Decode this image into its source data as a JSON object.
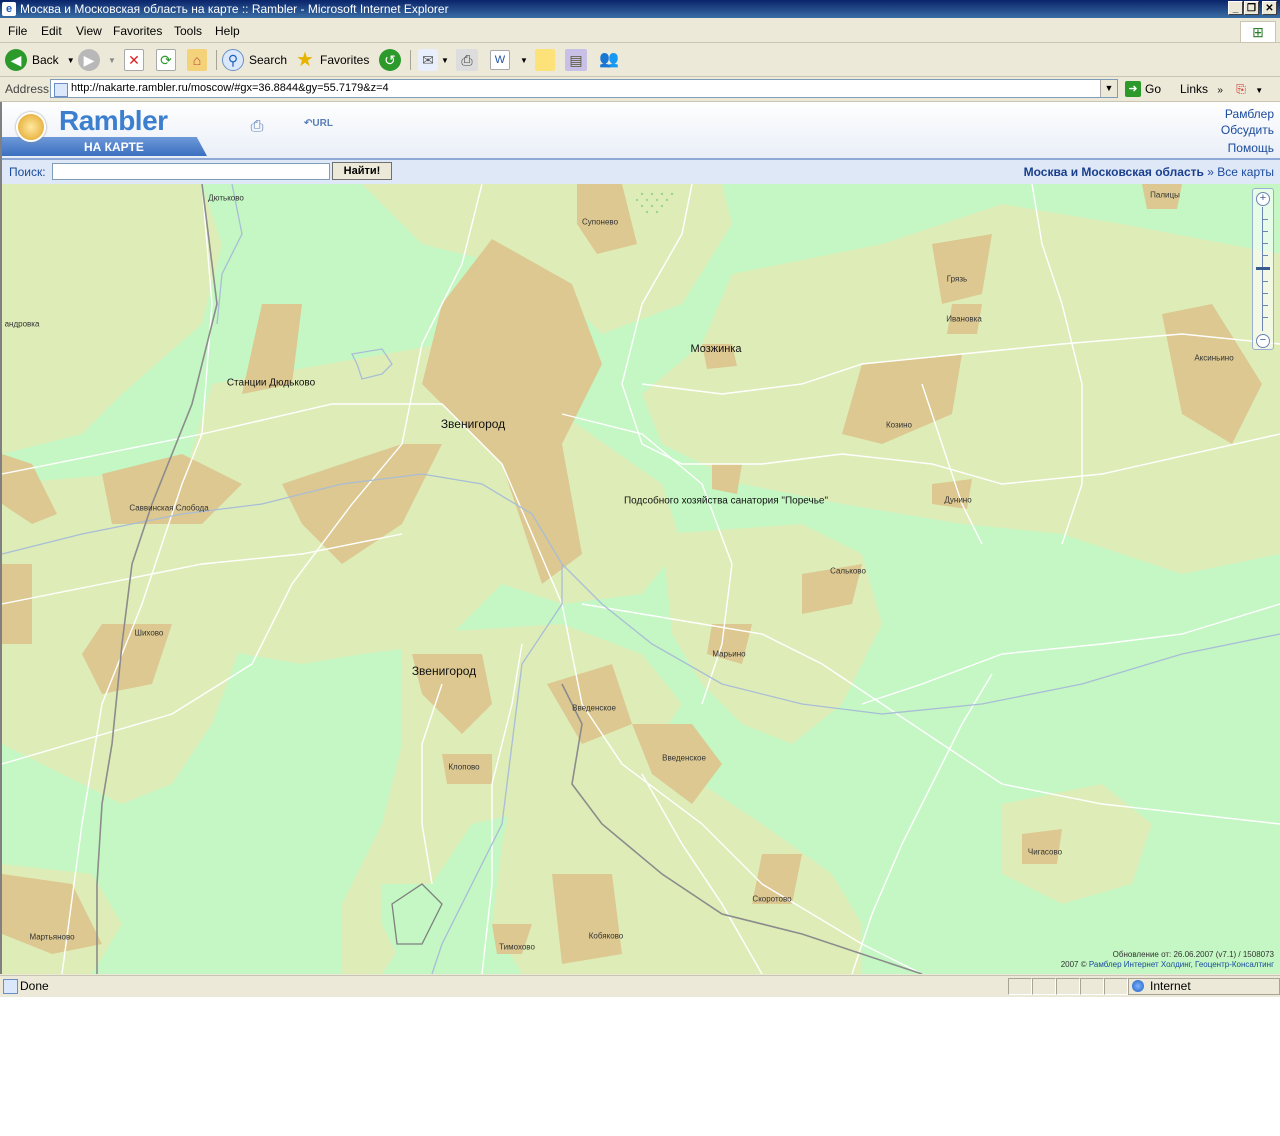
{
  "window": {
    "title": "Москва и Московская область на карте :: Rambler - Microsoft Internet Explorer",
    "buttons": [
      "_",
      "❐",
      "✕"
    ]
  },
  "menu": [
    "File",
    "Edit",
    "View",
    "Favorites",
    "Tools",
    "Help"
  ],
  "toolbar": {
    "back_label": "Back",
    "search_label": "Search",
    "favorites_label": "Favorites"
  },
  "address": {
    "label": "Address",
    "url": "http://nakarte.rambler.ru/moscow/#gx=36.8844&gy=55.7179&z=4",
    "go_label": "Go",
    "links_label": "Links"
  },
  "rambler": {
    "logo": "Rambler",
    "logo_sub": "НА КАРТЕ",
    "links": [
      "Рамблер",
      "Обсудить",
      "Помощь"
    ]
  },
  "search": {
    "label": "Поиск:",
    "value": "",
    "button": "Найти!",
    "region": "Москва и Московская область",
    "all_maps": "Все карты",
    "separator": "»"
  },
  "map": {
    "places": [
      {
        "name": "Дютьково",
        "big": false
      },
      {
        "name": "Супонево",
        "big": false
      },
      {
        "name": "Палицы",
        "big": false
      },
      {
        "name": "Грязь",
        "big": false
      },
      {
        "name": "Ивановка",
        "big": false
      },
      {
        "name": "андровка",
        "big": false
      },
      {
        "name": "Мозжинка",
        "big": true
      },
      {
        "name": "Аксиньино",
        "big": false
      },
      {
        "name": "Станции Дюдьково",
        "big": true
      },
      {
        "name": "Звенигород",
        "big": true
      },
      {
        "name": "Козино",
        "big": false
      },
      {
        "name": "Подсобного хозяйства санатория \"Поречье\"",
        "big": true
      },
      {
        "name": "Дунино",
        "big": false
      },
      {
        "name": "Саввинская Слобода",
        "big": false
      },
      {
        "name": "Сальково",
        "big": false
      },
      {
        "name": "Шихово",
        "big": false
      },
      {
        "name": "Марьино",
        "big": false
      },
      {
        "name": "Звенигород",
        "big": true
      },
      {
        "name": "Введенское",
        "big": false
      },
      {
        "name": "Введенское",
        "big": false
      },
      {
        "name": "Клопово",
        "big": false
      },
      {
        "name": "Чигасово",
        "big": false
      },
      {
        "name": "Скоротово",
        "big": false
      },
      {
        "name": "Мартьяново",
        "big": false
      },
      {
        "name": "Тимохово",
        "big": false
      },
      {
        "name": "Кобяково",
        "big": false
      }
    ],
    "update_text": "Обновление от: 26.06.2007 (v7.1) / 1508073",
    "copyright_prefix": "2007 ©",
    "copyright_links": "Рамблер Интернет Холдинг, Геоцентр-Консалтинг",
    "colors": {
      "forest": "#c4f7c4",
      "field": "#deedb8",
      "town": "#dcc890",
      "road": "#ffffff"
    }
  },
  "status": {
    "text": "Done",
    "zone": "Internet"
  }
}
